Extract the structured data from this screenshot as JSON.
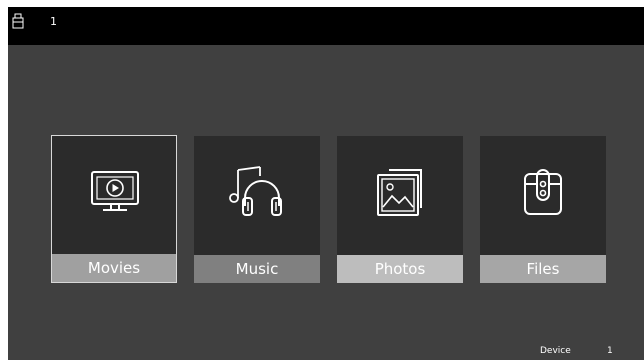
{
  "topbar": {
    "usb_count": "1",
    "usb_icon": "usb-drive-icon"
  },
  "tiles": [
    {
      "label": "Movies",
      "icon": "tv-play-icon",
      "label_bg": "#a0a0a0",
      "selected": true
    },
    {
      "label": "Music",
      "icon": "headphones-music-icon",
      "label_bg": "#808080",
      "selected": false
    },
    {
      "label": "Photos",
      "icon": "photos-icon",
      "label_bg": "#bdbdbd",
      "selected": false
    },
    {
      "label": "Files",
      "icon": "folder-clip-icon",
      "label_bg": "#a6a6a6",
      "selected": false
    }
  ],
  "footer": {
    "device_label": "Device",
    "device_count": "1"
  },
  "colors": {
    "background": "#404040",
    "topbar": "#000000",
    "tile": "#2b2b2b",
    "icon_stroke": "#ffffff"
  }
}
